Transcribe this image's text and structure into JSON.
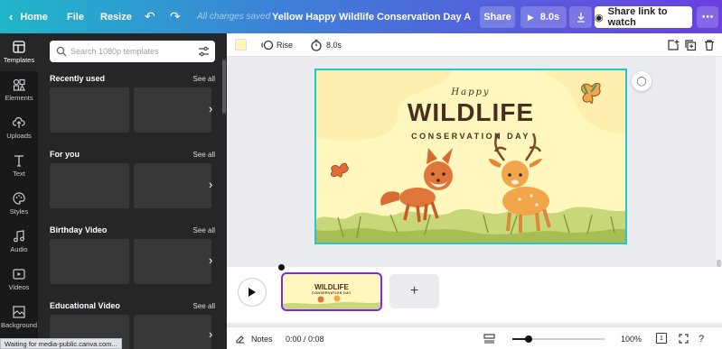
{
  "topbar": {
    "home_label": "Home",
    "file_label": "File",
    "resize_label": "Resize",
    "save_status": "All changes saved",
    "doc_title": "Yellow Happy Wildlife Conservation Day Animated Vi...",
    "share_label": "Share",
    "duration_label": "8.0s",
    "share_link_label": "Share link to watch"
  },
  "rail": {
    "items": [
      {
        "label": "Templates",
        "icon": "templates-icon"
      },
      {
        "label": "Elements",
        "icon": "elements-icon"
      },
      {
        "label": "Uploads",
        "icon": "upload-icon"
      },
      {
        "label": "Text",
        "icon": "text-icon"
      },
      {
        "label": "Styles",
        "icon": "palette-icon"
      },
      {
        "label": "Audio",
        "icon": "music-icon"
      },
      {
        "label": "Videos",
        "icon": "video-icon"
      },
      {
        "label": "Background",
        "icon": "background-icon"
      }
    ]
  },
  "panel": {
    "search_placeholder": "Search 1080p templates",
    "see_all": "See all",
    "sections": [
      {
        "title": "Recently used"
      },
      {
        "title": "For you"
      },
      {
        "title": "Birthday Video"
      },
      {
        "title": "Educational Video"
      }
    ]
  },
  "toolbar": {
    "animation_label": "Rise",
    "timing_label": "8.0s",
    "background_color": "#fff6b8"
  },
  "design": {
    "happy": "Happy",
    "title": "WILDLIFE",
    "subtitle": "CONSERVATION DAY"
  },
  "timeline": {
    "clip_title": "WILDLIFE",
    "clip_subtitle": "CONSERVATION DAY",
    "add_label": "+"
  },
  "footer": {
    "notes_label": "Notes",
    "time_label": "0:00 / 0:08",
    "zoom_label": "100%",
    "page_label": "1",
    "zoom_level": 0.18
  },
  "status": {
    "text": "Waiting for media-public.canva.com..."
  },
  "colors": {
    "accent": "#7d2ae8",
    "selection": "#24c6d0",
    "design_bg": "#fff7bd",
    "text_brown": "#4b2e20"
  }
}
